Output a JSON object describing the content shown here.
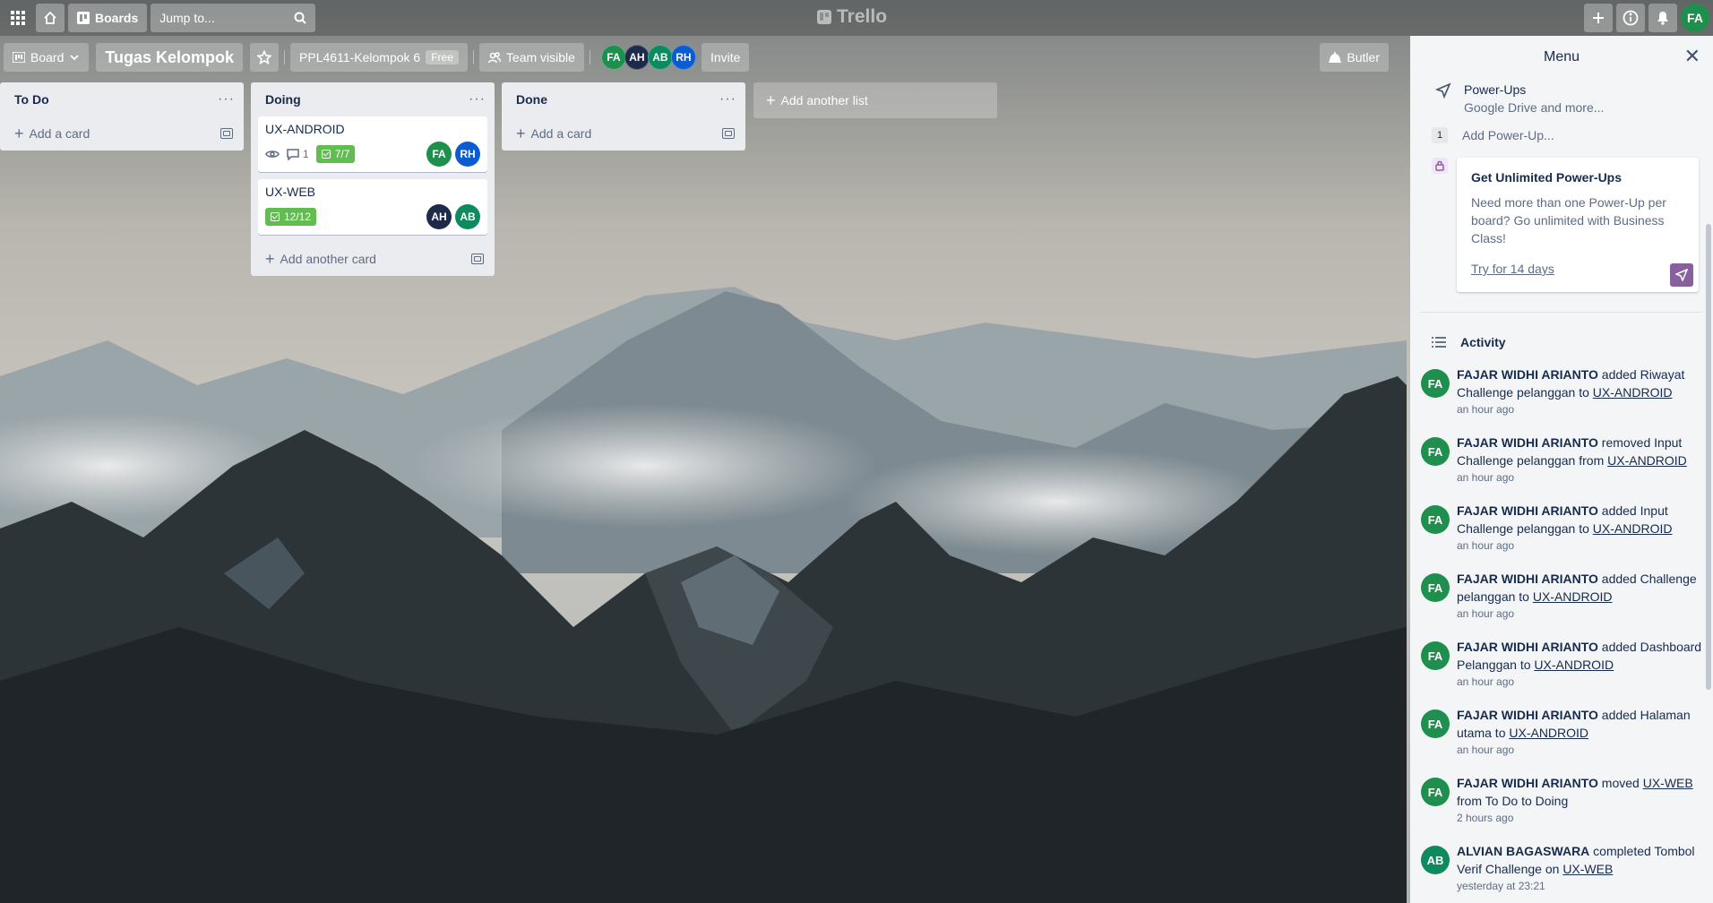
{
  "header": {
    "boards_label": "Boards",
    "jump_placeholder": "Jump to...",
    "logo": "Trello",
    "user_initials": "FA"
  },
  "board": {
    "view_label": "Board",
    "title": "Tugas Kelompok",
    "team": "PPL4611-Kelompok 6",
    "plan": "Free",
    "visibility": "Team visible",
    "members": [
      {
        "initials": "FA",
        "color": "#1f8f4e"
      },
      {
        "initials": "AH",
        "color": "#1d2a4a"
      },
      {
        "initials": "AB",
        "color": "#0e8a5f"
      },
      {
        "initials": "RH",
        "color": "#0b5bd1"
      }
    ],
    "invite_label": "Invite",
    "butler_label": "Butler"
  },
  "lists": [
    {
      "title": "To Do",
      "add_label": "Add a card",
      "cards": []
    },
    {
      "title": "Doing",
      "add_label": "Add another card",
      "cards": [
        {
          "title": "UX-ANDROID",
          "comments": "1",
          "checklist": "7/7",
          "members": [
            "FA",
            "RH"
          ]
        },
        {
          "title": "UX-WEB",
          "checklist": "12/12",
          "members": [
            "AH",
            "AB"
          ]
        }
      ]
    },
    {
      "title": "Done",
      "add_label": "Add a card",
      "cards": []
    }
  ],
  "add_list_label": "Add another list",
  "menu": {
    "title": "Menu",
    "powerups_title": "Power-Ups",
    "powerups_sub": "Google Drive and more...",
    "powerup_count": "1",
    "add_powerup": "Add Power-Up...",
    "promo_title": "Get Unlimited Power-Ups",
    "promo_body": "Need more than one Power-Up per board? Go unlimited with Business Class!",
    "promo_link": "Try for 14 days",
    "activity_title": "Activity",
    "activity": [
      {
        "initials": "FA",
        "user": "FAJAR WIDHI ARIANTO",
        "pre": " added Riwayat Challenge pelanggan to ",
        "link": "UX-ANDROID",
        "post": "",
        "time": "an hour ago"
      },
      {
        "initials": "FA",
        "user": "FAJAR WIDHI ARIANTO",
        "pre": " removed Input Challenge pelanggan from ",
        "link": "UX-ANDROID",
        "post": "",
        "time": "an hour ago"
      },
      {
        "initials": "FA",
        "user": "FAJAR WIDHI ARIANTO",
        "pre": " added Input Challenge pelanggan to ",
        "link": "UX-ANDROID",
        "post": "",
        "time": "an hour ago"
      },
      {
        "initials": "FA",
        "user": "FAJAR WIDHI ARIANTO",
        "pre": " added Challenge pelanggan to ",
        "link": "UX-ANDROID",
        "post": "",
        "time": "an hour ago"
      },
      {
        "initials": "FA",
        "user": "FAJAR WIDHI ARIANTO",
        "pre": " added Dashboard Pelanggan to ",
        "link": "UX-ANDROID",
        "post": "",
        "time": "an hour ago"
      },
      {
        "initials": "FA",
        "user": "FAJAR WIDHI ARIANTO",
        "pre": " added Halaman utama to ",
        "link": "UX-ANDROID",
        "post": "",
        "time": "an hour ago"
      },
      {
        "initials": "FA",
        "user": "FAJAR WIDHI ARIANTO",
        "pre": " moved ",
        "link": "UX-WEB",
        "post": " from To Do to Doing",
        "time": "2 hours ago"
      },
      {
        "initials": "AB",
        "user": "ALVIAN BAGASWARA",
        "pre": " completed Tombol Verif Challenge on ",
        "link": "UX-WEB",
        "post": "",
        "time": "yesterday at 23:21"
      }
    ]
  }
}
